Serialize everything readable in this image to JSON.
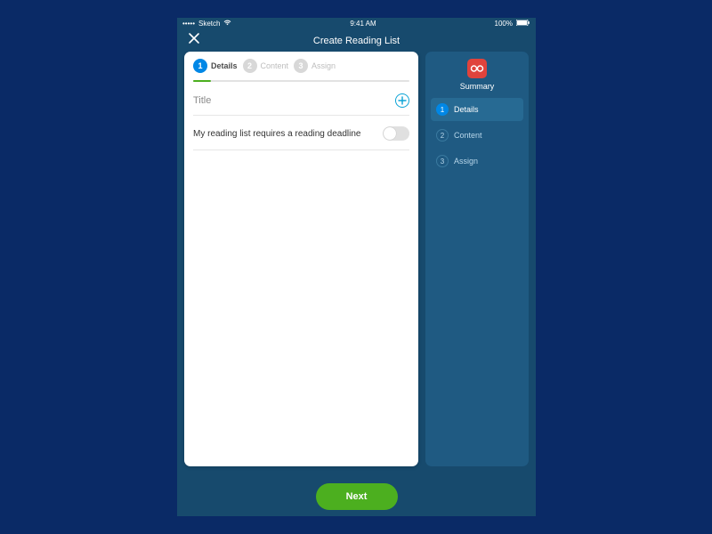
{
  "statusBar": {
    "carrier": "Sketch",
    "signal": "•••••",
    "time": "9:41 AM",
    "batteryText": "100%"
  },
  "header": {
    "title": "Create Reading List"
  },
  "stepper": {
    "steps": [
      {
        "num": "1",
        "label": "Details",
        "active": true
      },
      {
        "num": "2",
        "label": "Content",
        "active": false
      },
      {
        "num": "3",
        "label": "Assign",
        "active": false
      }
    ],
    "progressPercent": 8
  },
  "titleField": {
    "label": "Title"
  },
  "deadlineToggle": {
    "label": "My reading list requires a reading deadline",
    "on": false
  },
  "summary": {
    "title": "Summary",
    "items": [
      {
        "num": "1",
        "label": "Details",
        "active": true
      },
      {
        "num": "2",
        "label": "Content",
        "active": false
      },
      {
        "num": "3",
        "label": "Assign",
        "active": false
      }
    ]
  },
  "footer": {
    "nextLabel": "Next"
  }
}
